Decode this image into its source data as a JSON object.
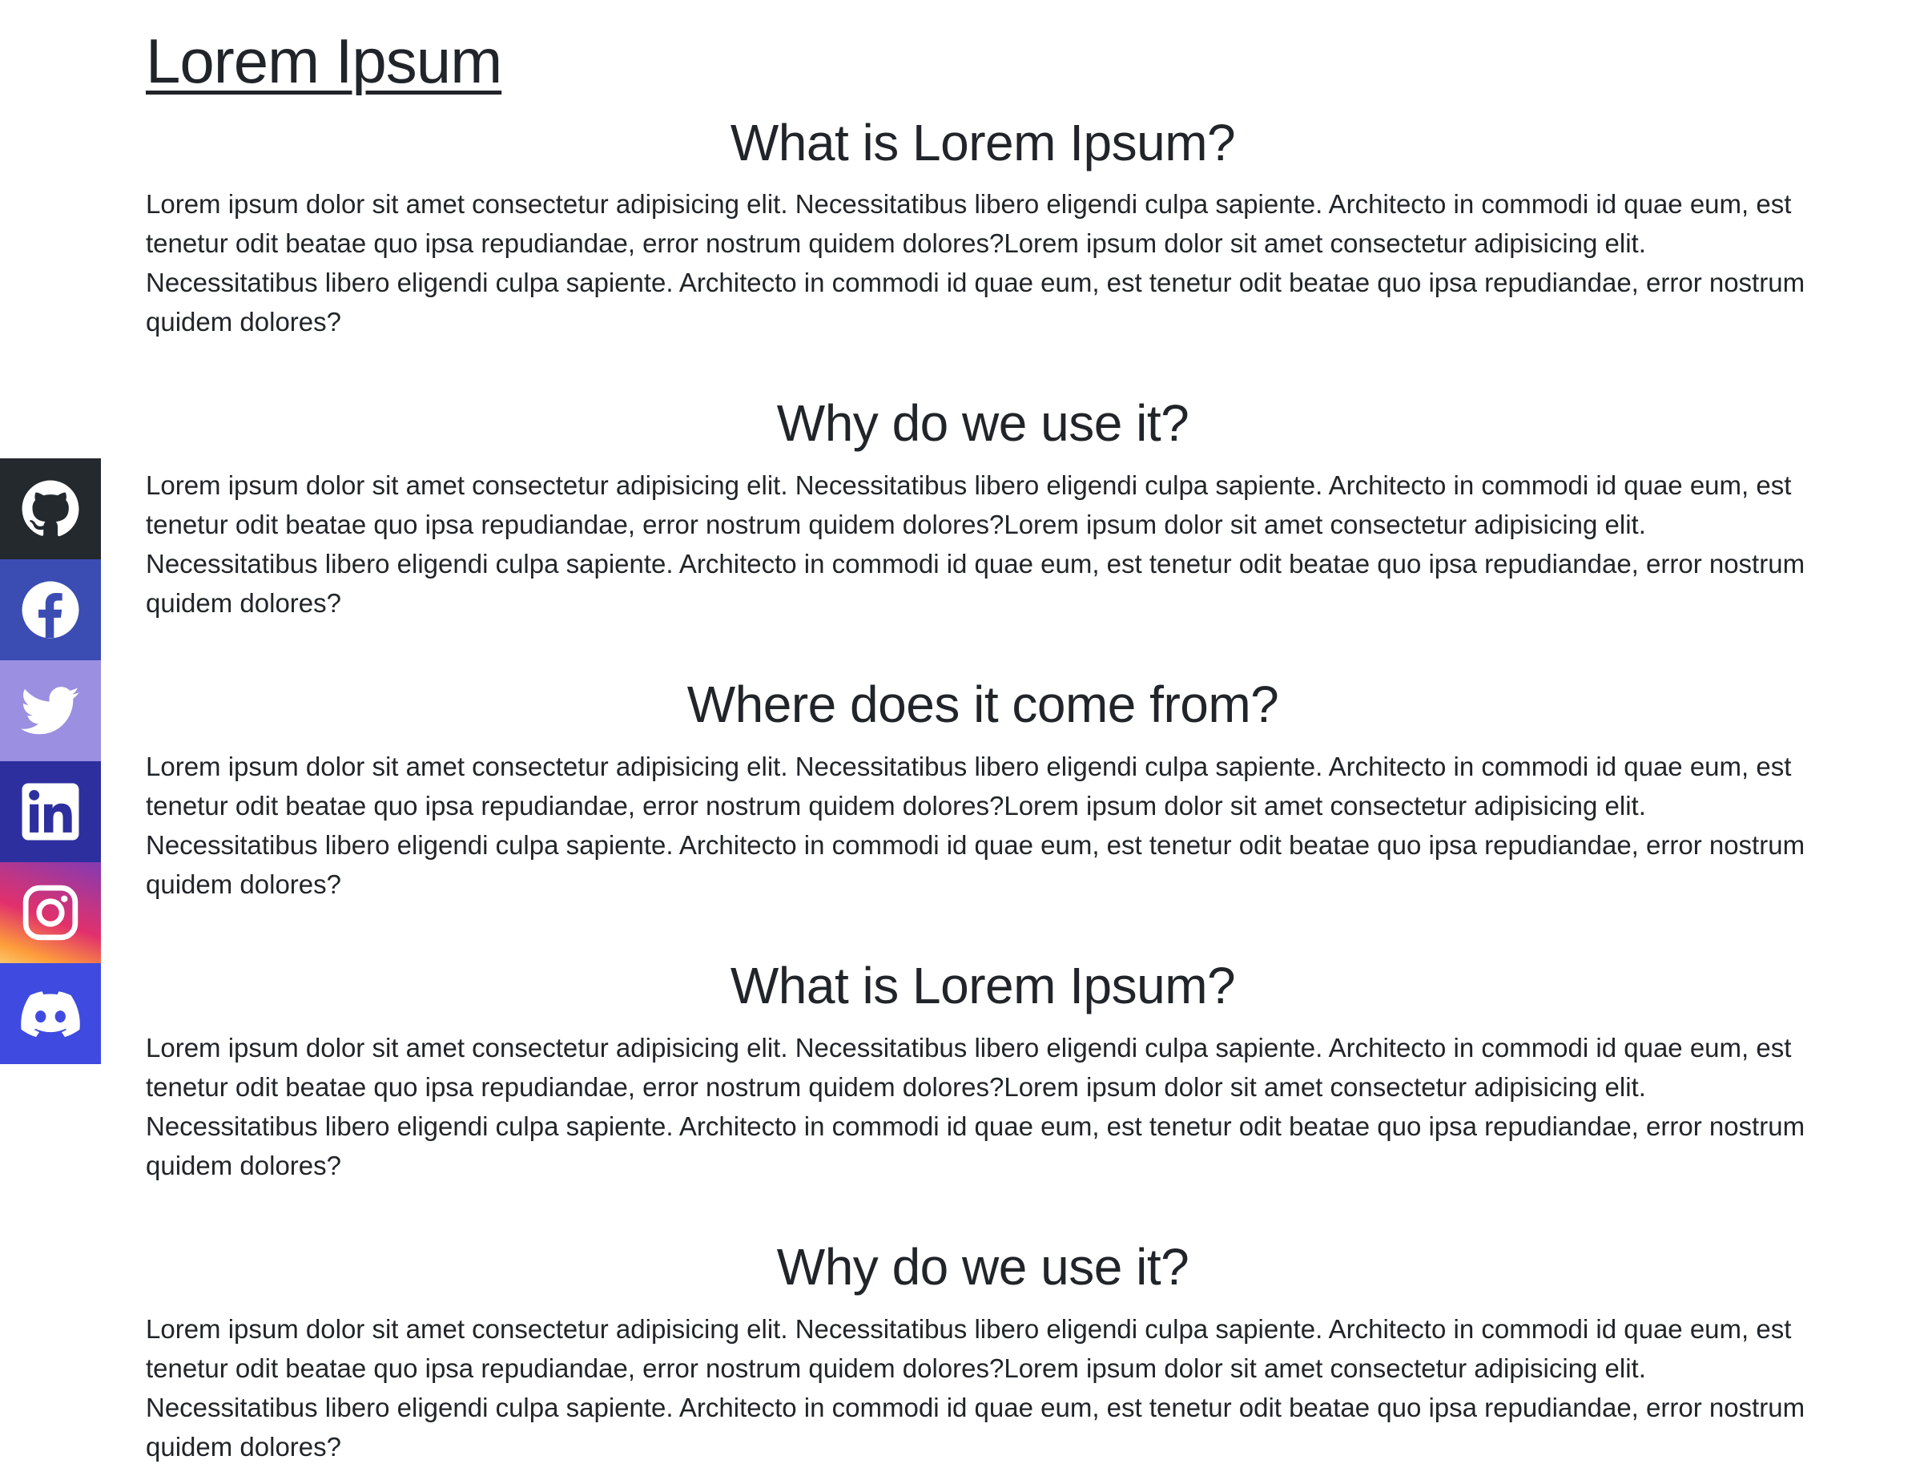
{
  "site_title": "Lorem Ipsum",
  "sections": [
    {
      "heading": "What is Lorem Ipsum?",
      "body": "Lorem ipsum dolor sit amet consectetur adipisicing elit. Necessitatibus libero eligendi culpa sapiente. Architecto in commodi id quae eum, est tenetur odit beatae quo ipsa repudiandae, error nostrum quidem dolores?Lorem ipsum dolor sit amet consectetur adipisicing elit. Necessitatibus libero eligendi culpa sapiente. Architecto in commodi id quae eum, est tenetur odit beatae quo ipsa repudiandae, error nostrum quidem dolores?"
    },
    {
      "heading": "Why do we use it?",
      "body": "Lorem ipsum dolor sit amet consectetur adipisicing elit. Necessitatibus libero eligendi culpa sapiente. Architecto in commodi id quae eum, est tenetur odit beatae quo ipsa repudiandae, error nostrum quidem dolores?Lorem ipsum dolor sit amet consectetur adipisicing elit. Necessitatibus libero eligendi culpa sapiente. Architecto in commodi id quae eum, est tenetur odit beatae quo ipsa repudiandae, error nostrum quidem dolores?"
    },
    {
      "heading": "Where does it come from?",
      "body": "Lorem ipsum dolor sit amet consectetur adipisicing elit. Necessitatibus libero eligendi culpa sapiente. Architecto in commodi id quae eum, est tenetur odit beatae quo ipsa repudiandae, error nostrum quidem dolores?Lorem ipsum dolor sit amet consectetur adipisicing elit. Necessitatibus libero eligendi culpa sapiente. Architecto in commodi id quae eum, est tenetur odit beatae quo ipsa repudiandae, error nostrum quidem dolores?"
    },
    {
      "heading": "What is Lorem Ipsum?",
      "body": "Lorem ipsum dolor sit amet consectetur adipisicing elit. Necessitatibus libero eligendi culpa sapiente. Architecto in commodi id quae eum, est tenetur odit beatae quo ipsa repudiandae, error nostrum quidem dolores?Lorem ipsum dolor sit amet consectetur adipisicing elit. Necessitatibus libero eligendi culpa sapiente. Architecto in commodi id quae eum, est tenetur odit beatae quo ipsa repudiandae, error nostrum quidem dolores?"
    },
    {
      "heading": "Why do we use it?",
      "body": "Lorem ipsum dolor sit amet consectetur adipisicing elit. Necessitatibus libero eligendi culpa sapiente. Architecto in commodi id quae eum, est tenetur odit beatae quo ipsa repudiandae, error nostrum quidem dolores?Lorem ipsum dolor sit amet consectetur adipisicing elit. Necessitatibus libero eligendi culpa sapiente. Architecto in commodi id quae eum, est tenetur odit beatae quo ipsa repudiandae, error nostrum quidem dolores?"
    }
  ],
  "social_links": [
    {
      "icon": "github-icon",
      "color": "#24292e"
    },
    {
      "icon": "facebook-icon",
      "color": "#3b4db3"
    },
    {
      "icon": "twitter-icon",
      "color": "#9a8fe0"
    },
    {
      "icon": "linkedin-icon",
      "color": "#2e2f9e"
    },
    {
      "icon": "instagram-icon",
      "color": "#c13584"
    },
    {
      "icon": "discord-icon",
      "color": "#3f4be0"
    }
  ],
  "colors": {
    "text": "#212529",
    "background": "#ffffff"
  }
}
